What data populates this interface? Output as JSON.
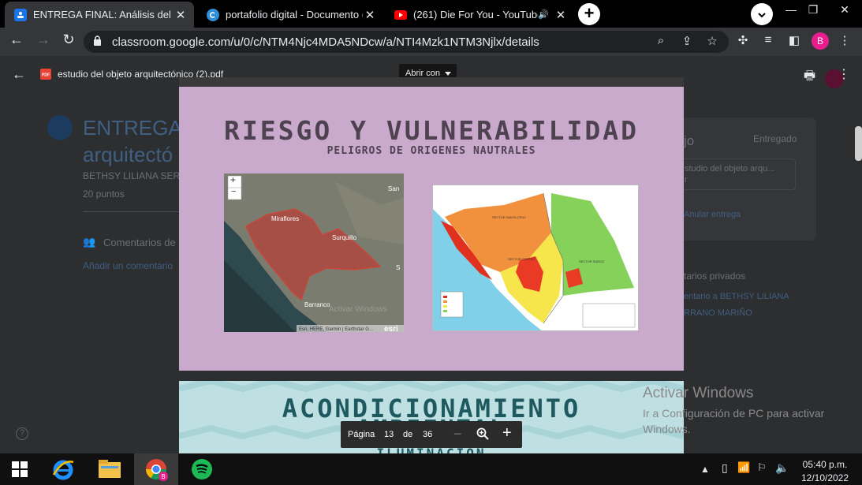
{
  "browser": {
    "tabs": [
      {
        "title": "ENTREGA FINAL: Análisis del obje",
        "favicon": "classroom-icon",
        "active": true
      },
      {
        "title": "portafolio digital - Documento (A",
        "favicon": "canva-icon",
        "active": false
      },
      {
        "title": "(261) Die For You - YouTube",
        "favicon": "youtube-icon",
        "active": false,
        "audio": true
      }
    ],
    "url": "classroom.google.com/u/0/c/NTM4Njc4MDA5NDcw/a/NTI4Mzk1NTM3Njlx/details",
    "profile_initial": "B"
  },
  "classroom": {
    "title_line1": "ENTREGA",
    "title_line2": "arquitectó",
    "author": "BETHSY LILIANA SER",
    "points": "20 puntos",
    "comments_label": "Comentarios de",
    "add_comment": "Añadir un comentario",
    "right_card": {
      "heading": "jo",
      "status": "Entregado",
      "file": "studio del objeto arqu...",
      "file_sub": "r",
      "unsubmit": "Anular entrega"
    },
    "private_comments": "tarios privados",
    "private_comment_link_1": "entario a BETHSY LILIANA",
    "private_comment_link_2": "RRANO MARIÑO"
  },
  "viewer": {
    "filename": "estudio del objeto arquitectónico (2).pdf",
    "open_with": "Abrir con",
    "page_label": "Página",
    "current_page": "13",
    "of_label": "de",
    "total_pages": "36"
  },
  "slide1": {
    "title": "RIESGO Y VULNERABILIDAD",
    "subtitle": "PELIGROS DE ORIGENES NAUTRALES",
    "sat_map": {
      "labels": {
        "miraflores": "Miraflores",
        "surquillo": "Surquillo",
        "barranco": "Barranco",
        "san": "San",
        "s": "S"
      },
      "zoom_in": "+",
      "zoom_out": "−",
      "attribution": "Esri, HERE, Garmin | Earthstar G...",
      "brand": "esri",
      "watermark": "Activar Windows"
    },
    "hazard_map": {
      "zone_labels": [
        "SECTOR SANTA CRUZ",
        "SECTOR CENTRO",
        "SECTOR SURCO"
      ]
    }
  },
  "slide2": {
    "title": "ACONDICIONAMIENTO",
    "line2": "AMBIENTAL",
    "line3": "ILUMINACIÓN"
  },
  "watermark": {
    "line1": "Activar Windows",
    "line2": "Ir a Configuración de PC para activar Windows."
  },
  "taskbar": {
    "time": "05:40 p.m.",
    "date": "12/10/2022"
  },
  "colors": {
    "slide1_bg": "#c9aacd",
    "slide2_bg": "#bfe0e3",
    "profile": "#e91e8c"
  }
}
